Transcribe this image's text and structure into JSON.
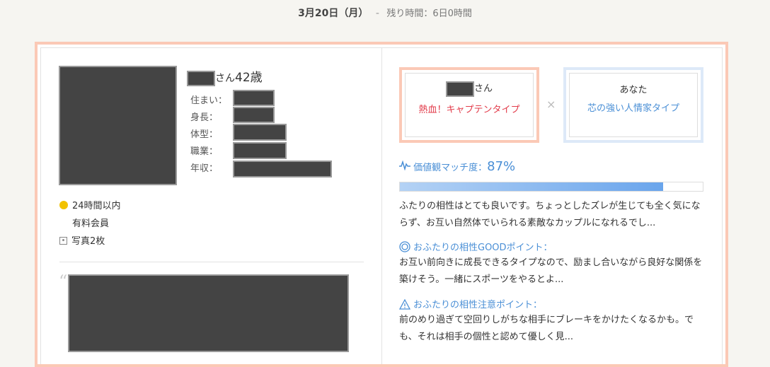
{
  "header": {
    "date": "3月20日（月）",
    "separator": "-",
    "remaining": "残り時間：6日0時間"
  },
  "profile": {
    "name_suffix": "さん",
    "age": "42歳",
    "labels": [
      "住まい：",
      "身長：",
      "体型：",
      "職業：",
      "年収："
    ],
    "status_online": "24時間以内",
    "membership": "有料会員",
    "photos": "写真2枚"
  },
  "match": {
    "partner_suffix": "さん",
    "partner_type": "熱血！キャプテンタイプ",
    "you_label": "あなた",
    "you_type": "芯の強い人情家タイプ",
    "cross": "×",
    "score_label": "価値観マッチ度：",
    "score": "87%",
    "score_value": 0.87,
    "summary": "ふたりの相性はとても良いです。ちょっとしたズレが生じても全く気にならず、お互い自然体でいられる素敵なカップルになれるでし...",
    "good_head": "おふたりの相性GOODポイント：",
    "good_text": "お互い前向きに成長できるタイプなので、励まし合いながら良好な関係を築けそう。一緒にスポーツをやるとよ...",
    "caution_head": "おふたりの相性注意ポイント：",
    "caution_text": "前のめり過ぎて空回りしがちな相手にブレーキをかけたくなるかも。でも、それは相手の個性と認めて優しく見..."
  },
  "colors": {
    "card_border": "#fbc9b6",
    "you_border": "#dde9f8",
    "accent_blue": "#4a8fd6",
    "partner_red": "#e23b4a",
    "online_dot": "#f2c200"
  }
}
